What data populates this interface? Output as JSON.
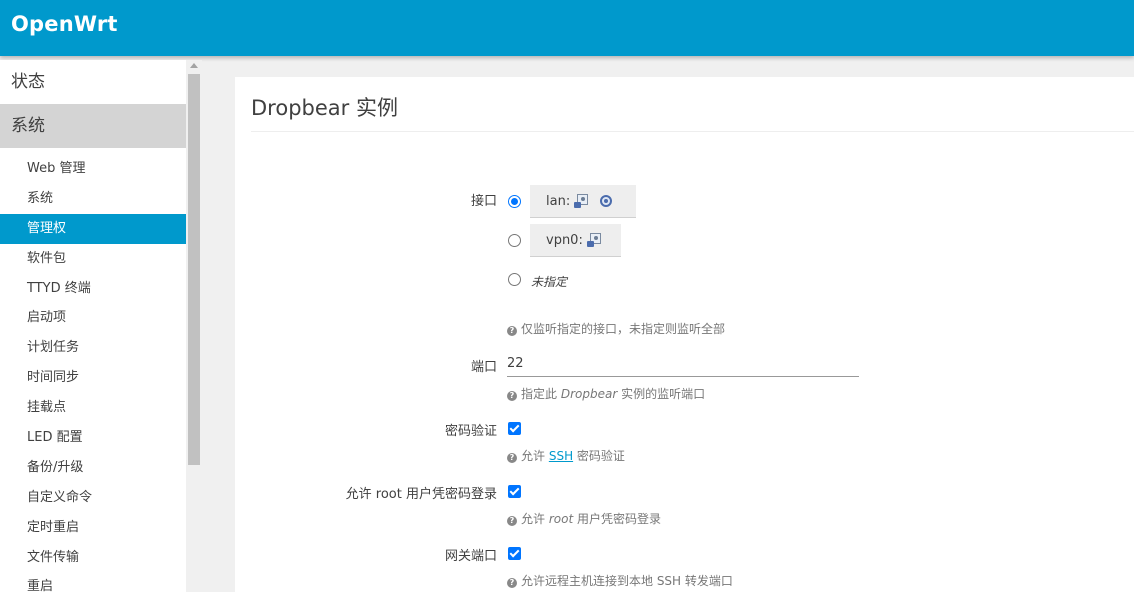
{
  "header": {
    "brand": "OpenWrt"
  },
  "sidebar": {
    "top_items": [
      {
        "label": "状态"
      },
      {
        "label": "系统"
      }
    ],
    "sub_items": [
      {
        "label": "Web 管理"
      },
      {
        "label": "系统"
      },
      {
        "label": "管理权"
      },
      {
        "label": "软件包"
      },
      {
        "label": "TTYD 终端"
      },
      {
        "label": "启动项"
      },
      {
        "label": "计划任务"
      },
      {
        "label": "时间同步"
      },
      {
        "label": "挂载点"
      },
      {
        "label": "LED 配置"
      },
      {
        "label": "备份/升级"
      },
      {
        "label": "自定义命令"
      },
      {
        "label": "定时重启"
      },
      {
        "label": "文件传输"
      },
      {
        "label": "重启"
      }
    ],
    "active_top": "系统",
    "active_sub": "管理权"
  },
  "main": {
    "title": "Dropbear 实例",
    "interface": {
      "label": "接口",
      "options": [
        {
          "name": "lan:",
          "checked": true,
          "icons": [
            "ethernet-port-icon",
            "wireless-icon"
          ]
        },
        {
          "name": "vpn0:",
          "checked": false,
          "icons": [
            "ethernet-port-icon"
          ]
        }
      ],
      "unspecified_label": "未指定",
      "help": "仅监听指定的接口，未指定则监听全部"
    },
    "port": {
      "label": "端口",
      "value": "22",
      "help_prefix": "指定此 ",
      "help_em": "Dropbear",
      "help_suffix": " 实例的监听端口"
    },
    "password_auth": {
      "label": "密码验证",
      "checked": true,
      "help_prefix": "允许 ",
      "help_link": "SSH",
      "help_suffix": " 密码验证"
    },
    "root_password": {
      "label": "允许 root 用户凭密码登录",
      "checked": true,
      "help_prefix": "允许 ",
      "help_em": "root",
      "help_suffix": " 用户凭密码登录"
    },
    "gateway_ports": {
      "label": "网关端口",
      "checked": true,
      "help": "允许远程主机连接到本地 SSH 转发端口"
    }
  },
  "colors": {
    "header_bg": "#0099cc",
    "active_item_bg": "#0099cc",
    "active_section_bg": "#d4d4d4",
    "control_accent": "#0075ff"
  }
}
